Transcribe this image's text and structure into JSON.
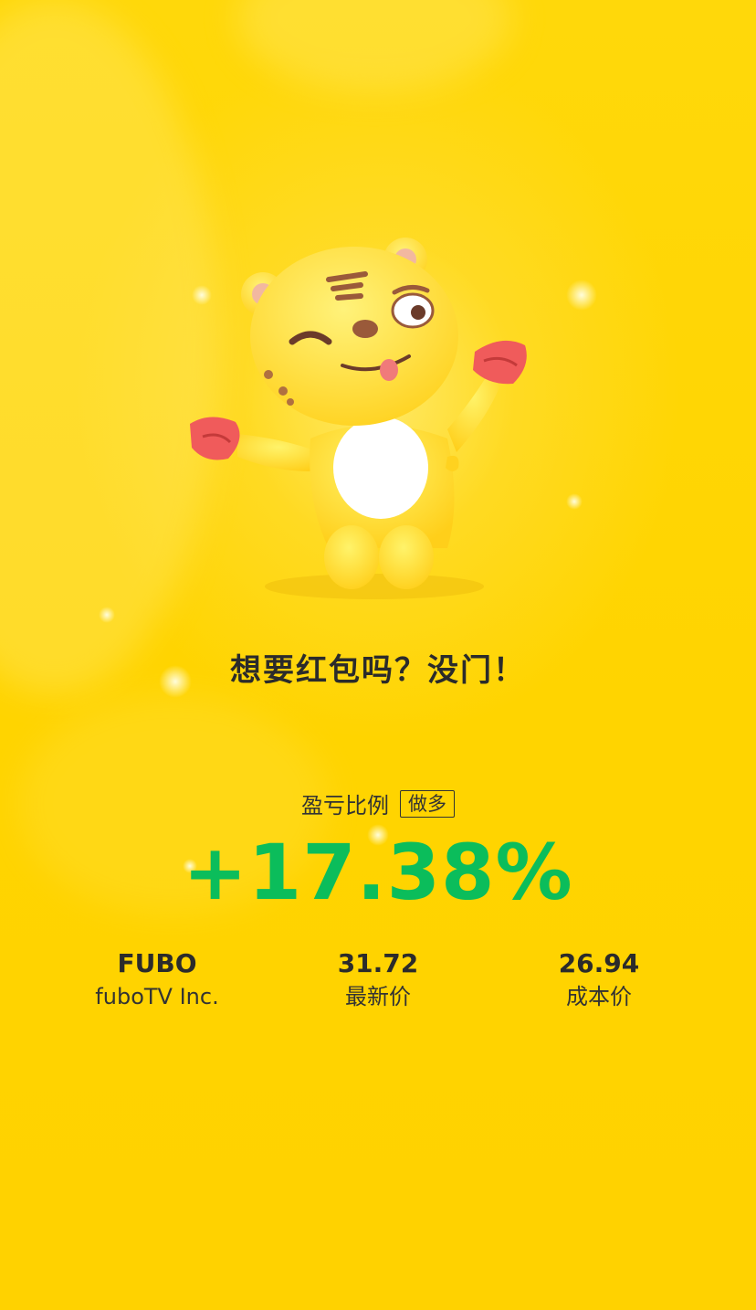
{
  "headline": "想要红包吗？没门！",
  "ratio": {
    "label": "盈亏比例",
    "badge": "做多",
    "value": "+17.38%",
    "color": "#0bbd5b"
  },
  "stats": [
    {
      "value": "FUBO",
      "label": "fuboTV Inc."
    },
    {
      "value": "31.72",
      "label": "最新价"
    },
    {
      "value": "26.94",
      "label": "成本价"
    }
  ],
  "mascot": {
    "icon": "tiger-mascot-icon"
  },
  "colors": {
    "background": "#ffd400",
    "text": "#2b2b2b",
    "gain": "#0bbd5b"
  }
}
